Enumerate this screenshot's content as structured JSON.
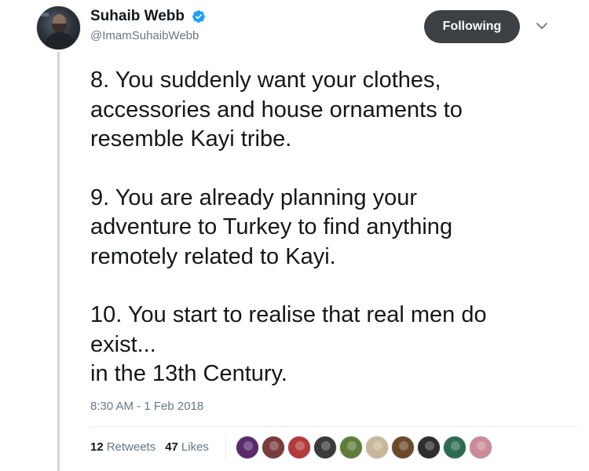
{
  "author": {
    "display_name": "Suhaib Webb",
    "handle": "@ImamSuhaibWebb",
    "verified": true
  },
  "follow_button": {
    "label": "Following"
  },
  "tweet": {
    "paragraphs": [
      "8. You suddenly want your clothes,\naccessories and house ornaments to\nresemble Kayi tribe.",
      "9. You are already planning your\nadventure to Turkey to find anything\nremotely related to Kayi.",
      "10. You start to realise that real men do\nexist...\nin the 13th Century."
    ],
    "timestamp": "8:30 AM - 1 Feb 2018"
  },
  "stats": {
    "retweets_count": "12",
    "retweets_label": "Retweets",
    "likes_count": "47",
    "likes_label": "Likes"
  },
  "likers": [
    {
      "color": "#5a2a6b"
    },
    {
      "color": "#7a3b3b"
    },
    {
      "color": "#b33a3a"
    },
    {
      "color": "#3a3a3a"
    },
    {
      "color": "#5f7d3a"
    },
    {
      "color": "#c9b79a"
    },
    {
      "color": "#6b4a2a"
    },
    {
      "color": "#2e2e2e"
    },
    {
      "color": "#2f6b4f"
    },
    {
      "color": "#c98a9a"
    },
    {
      "color": "#b02a4a"
    },
    {
      "color": "#8a8a7a"
    }
  ],
  "colors": {
    "verified": "#1da1f2",
    "follow_button_bg": "#3d4145",
    "secondary_text": "#657786",
    "thread_line": "#ccd6dd"
  },
  "icons": [
    "verified-badge-icon",
    "chevron-down-icon"
  ]
}
